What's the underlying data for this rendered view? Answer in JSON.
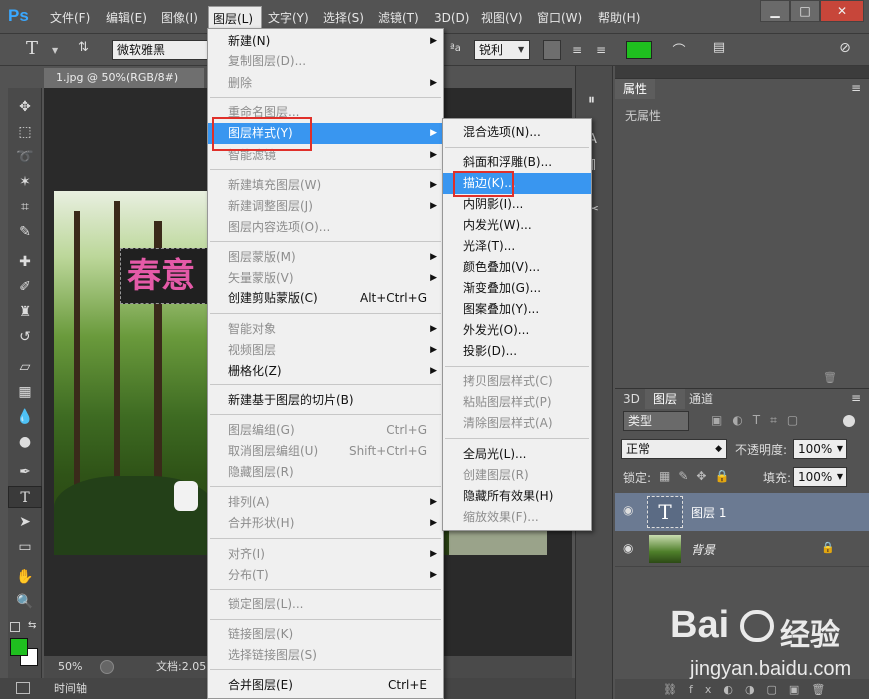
{
  "app": {
    "logo": "Ps"
  },
  "menubar": {
    "items": [
      "文件(F)",
      "编辑(E)",
      "图像(I)",
      "图层(L)",
      "文字(Y)",
      "选择(S)",
      "滤镜(T)",
      "3D(D)",
      "视图(V)",
      "窗口(W)",
      "帮助(H)"
    ],
    "selected_index": 3
  },
  "window_controls": {
    "minimize": "▁",
    "maximize": "□",
    "close": "✕"
  },
  "options_bar": {
    "tool_icon": "T",
    "font_family": "微软雅黑",
    "antialias": "锐利",
    "text_color": "#1fbf1f"
  },
  "document": {
    "tab_title": "1.jpg @ 50%(RGB/8#)",
    "canvas_text": "春意"
  },
  "status": {
    "zoom": "50%",
    "doc_info": "文档:2.05"
  },
  "timeline": {
    "label": "时间轴"
  },
  "properties": {
    "tab": "属性",
    "empty_text": "无属性"
  },
  "layers_panel": {
    "tabs": [
      "3D",
      "图层",
      "通道"
    ],
    "filter_kind": "类型",
    "blend_mode": "正常",
    "opacity_label": "不透明度:",
    "opacity_value": "100%",
    "lock_label": "锁定:",
    "fill_label": "填充:",
    "fill_value": "100%",
    "layers": [
      {
        "name": "图层 1",
        "thumb": "T"
      },
      {
        "name": "背景"
      }
    ]
  },
  "layer_menu": {
    "items": [
      {
        "label": "新建(N)",
        "arrow": true
      },
      {
        "label": "复制图层(D)...",
        "disabled": true
      },
      {
        "label": "删除",
        "disabled": true,
        "arrow": true
      },
      {
        "label": "重命名图层...",
        "disabled": true
      },
      {
        "label": "图层样式(Y)",
        "arrow": true,
        "highlighted": true
      },
      {
        "label": "智能滤镜",
        "disabled": true,
        "arrow": true
      },
      {
        "label": "新建填充图层(W)",
        "disabled": true,
        "arrow": true
      },
      {
        "label": "新建调整图层(J)",
        "disabled": true,
        "arrow": true
      },
      {
        "label": "图层内容选项(O)...",
        "disabled": true
      },
      {
        "label": "图层蒙版(M)",
        "disabled": true,
        "arrow": true
      },
      {
        "label": "矢量蒙版(V)",
        "disabled": true,
        "arrow": true
      },
      {
        "label": "创建剪贴蒙版(C)",
        "shortcut": "Alt+Ctrl+G"
      },
      {
        "label": "智能对象",
        "disabled": true,
        "arrow": true
      },
      {
        "label": "视频图层",
        "disabled": true,
        "arrow": true
      },
      {
        "label": "栅格化(Z)",
        "arrow": true
      },
      {
        "label": "新建基于图层的切片(B)"
      },
      {
        "label": "图层编组(G)",
        "disabled": true,
        "shortcut": "Ctrl+G"
      },
      {
        "label": "取消图层编组(U)",
        "disabled": true,
        "shortcut": "Shift+Ctrl+G"
      },
      {
        "label": "隐藏图层(R)",
        "disabled": true
      },
      {
        "label": "排列(A)",
        "disabled": true,
        "arrow": true
      },
      {
        "label": "合并形状(H)",
        "disabled": true,
        "arrow": true
      },
      {
        "label": "对齐(I)",
        "disabled": true,
        "arrow": true
      },
      {
        "label": "分布(T)",
        "disabled": true,
        "arrow": true
      },
      {
        "label": "锁定图层(L)...",
        "disabled": true
      },
      {
        "label": "链接图层(K)",
        "disabled": true
      },
      {
        "label": "选择链接图层(S)",
        "disabled": true
      },
      {
        "label": "合并图层(E)",
        "shortcut": "Ctrl+E"
      }
    ]
  },
  "style_submenu": {
    "items": [
      {
        "label": "混合选项(N)..."
      },
      {
        "label": "斜面和浮雕(B)..."
      },
      {
        "label": "描边(K)...",
        "highlighted": true
      },
      {
        "label": "内阴影(I)..."
      },
      {
        "label": "内发光(W)..."
      },
      {
        "label": "光泽(T)..."
      },
      {
        "label": "颜色叠加(V)..."
      },
      {
        "label": "渐变叠加(G)..."
      },
      {
        "label": "图案叠加(Y)..."
      },
      {
        "label": "外发光(O)..."
      },
      {
        "label": "投影(D)..."
      },
      {
        "label": "拷贝图层样式(C)",
        "disabled": true
      },
      {
        "label": "粘贴图层样式(P)",
        "disabled": true
      },
      {
        "label": "清除图层样式(A)",
        "disabled": true
      },
      {
        "label": "全局光(L)..."
      },
      {
        "label": "创建图层(R)",
        "disabled": true
      },
      {
        "label": "隐藏所有效果(H)"
      },
      {
        "label": "缩放效果(F)...",
        "disabled": true
      }
    ]
  },
  "watermark": {
    "brand": "Bai",
    "brand_tail": "经验",
    "url": "jingyan.baidu.com"
  },
  "colors": {
    "menu_highlight": "#3996f0",
    "annotation": "#e0302a",
    "foreground": "#1fbf1f",
    "background": "#ffffff"
  }
}
